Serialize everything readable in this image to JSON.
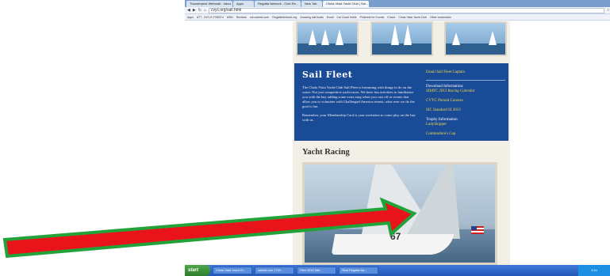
{
  "browser": {
    "tabs": [
      {
        "label": "Thunderpest Webmail - Inbox"
      },
      {
        "label": "Apps"
      },
      {
        "label": "Regatta Network - Club Re..."
      },
      {
        "label": "New Tab"
      },
      {
        "label": "Chula Vista Yacht Club | Sai...",
        "active": true
      }
    ],
    "url": "cvyc.org/sail.html",
    "bookmarks": [
      "Apps",
      "ATT - INTLS 2798374",
      "MSN",
      "Reviews",
      "cdn.sailnet.com",
      "RegattaNetwork.org",
      "Amazing sail boats",
      "Email",
      "Cal Coast Hollie",
      "Pinterest for Koontz",
      "iCloud",
      "Chula Vista Yacht Club",
      "Other bookmarks"
    ]
  },
  "sail_fleet": {
    "title": "Sail Fleet",
    "paragraph1": "The Chula Vista Yacht Club Sail Fleet is brimming with things to do on the water. Not just competitive yacht races. We have fun activities to familiarize you with the bay adding some extra zing when you cast off or events that allow you to volunteer with Challenged America events, what ever we do the goal is fun.",
    "paragraph2": "Remember, your Membership Card is your invitation to come play on the bay with us.",
    "links": {
      "email_captain": "Email Sail Fleet Captain",
      "download_info": "Download Information:",
      "racing_calendar": "SDAYC 2013 Racing Calendar",
      "pursuit_courses": "CVYC Pursuit Courses",
      "sic_standard": "SIC Standard SI 2013",
      "trophy_info": "Trophy Information",
      "ladyskipper": "LadySkipper",
      "commodores_cup": "Commodore's Cup"
    }
  },
  "racing": {
    "title": "Yacht Racing",
    "sail_number": "67"
  },
  "taskbar": {
    "start": "start",
    "items": [
      "Chula Vista Yacht Cl...",
      "sailnet.com 1734...",
      "Glen 2013 Sail...",
      "Start Regatta Ba..."
    ],
    "tray": "3:44"
  },
  "annotation": {
    "arrow_colors": {
      "fill": "#e8141a",
      "outline": "#22a33a"
    }
  }
}
